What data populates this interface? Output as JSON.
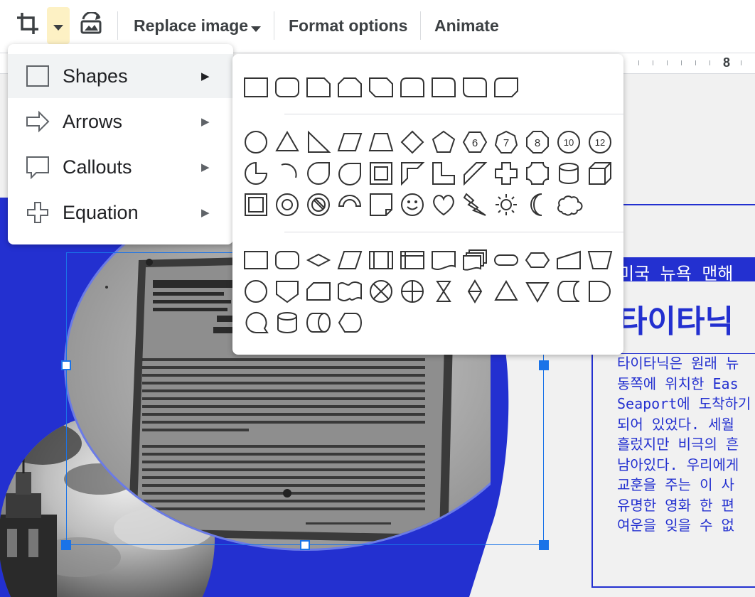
{
  "toolbar": {
    "crop_icon": "crop-icon",
    "dropdown_icon": "caret-down-icon",
    "reset_icon": "reset-image-icon",
    "replace_image": "Replace image",
    "format_options": "Format options",
    "animate": "Animate"
  },
  "ruler": {
    "mark": "8"
  },
  "mask_menu": {
    "items": [
      {
        "label": "Shapes",
        "icon": "rectangle-icon",
        "arrow": "▶"
      },
      {
        "label": "Arrows",
        "icon": "arrow-right-icon",
        "arrow": "▶"
      },
      {
        "label": "Callouts",
        "icon": "callout-icon",
        "arrow": "▶"
      },
      {
        "label": "Equation",
        "icon": "plus-icon",
        "arrow": "▶"
      }
    ]
  },
  "shape_numbers": [
    "6",
    "7",
    "8",
    "10",
    "12"
  ],
  "slide": {
    "location_tag": "미국 뉴욕 맨해",
    "title": "타이타닉 ",
    "body_lines": [
      "타이타닉은 원래 뉴",
      "동쪽에 위치한 Eas",
      "Seaport에 도착하기",
      "되어 있었다. 세월",
      "흘렀지만 비극의 흔",
      "남아있다. 우리에게",
      "교훈을 주는 이 사",
      "유명한 영화 한 편",
      "여운을 잊을 수 없"
    ],
    "photo_plaque": "TITANIC MEMORIAL plaque",
    "colors": {
      "accent": "#2330d0",
      "handle": "#1a73e8"
    }
  }
}
